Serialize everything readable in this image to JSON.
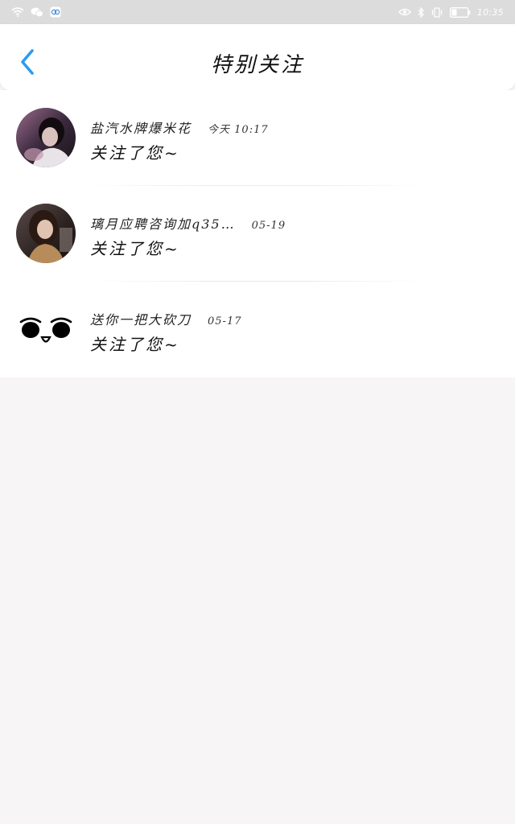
{
  "status_bar": {
    "time": "10:35",
    "icons": [
      "wifi-icon",
      "wechat-icon",
      "app-notification-icon",
      "eye-icon",
      "bluetooth-icon",
      "vibrate-icon",
      "battery-icon"
    ]
  },
  "header": {
    "title": "特别关注",
    "back_icon": "chevron-left-icon",
    "accent_color": "#2b9cf2"
  },
  "items": [
    {
      "name": "盐汽水牌爆米花",
      "time": "今天 10:17",
      "message": "关注了您~",
      "avatar": "photo-avatar"
    },
    {
      "name": "璃月应聘咨询加q35…",
      "time": "05-19",
      "message": "关注了您~",
      "avatar": "photo-avatar"
    },
    {
      "name": "送你一把大砍刀",
      "time": "05-17",
      "message": "关注了您~",
      "avatar": "face-avatar"
    }
  ]
}
